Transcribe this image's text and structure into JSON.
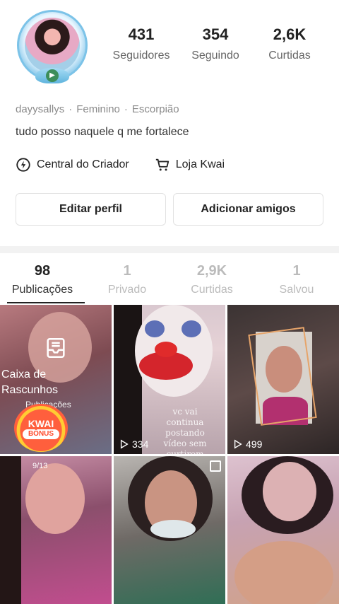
{
  "profile": {
    "stats": [
      {
        "value": "431",
        "label": "Seguidores"
      },
      {
        "value": "354",
        "label": "Seguindo"
      },
      {
        "value": "2,6K",
        "label": "Curtidas"
      }
    ],
    "username": "dayysallys",
    "gender": "Feminino",
    "sign": "Escorpião",
    "separator": "·",
    "bio": "tudo posso naquele q me fortalece"
  },
  "links": {
    "creator_center": "Central do Criador",
    "shop": "Loja Kwai"
  },
  "buttons": {
    "edit_profile": "Editar perfil",
    "add_friends": "Adicionar amigos"
  },
  "tabs": [
    {
      "value": "98",
      "label": "Publicações",
      "active": true
    },
    {
      "value": "1",
      "label": "Privado"
    },
    {
      "value": "2,9K",
      "label": "Curtidas"
    },
    {
      "value": "1",
      "label": "Salvou"
    }
  ],
  "grid": {
    "drafts_title": "Caixa de Rascunhos",
    "drafts_sub": "Publicações",
    "kwai_badge_top": "KWAI",
    "kwai_badge_bottom": "BÔNUS",
    "post2_plays": "334",
    "post2_overlay": "vc vai continua postando vídeo sem curtirem",
    "post3_plays": "499",
    "post4_pages": "9/13"
  },
  "colors": {
    "text_primary": "#222222",
    "text_secondary": "#8a8a8a",
    "divider": "#f2f2f2",
    "kwai_badge": "#ff5f3d"
  }
}
